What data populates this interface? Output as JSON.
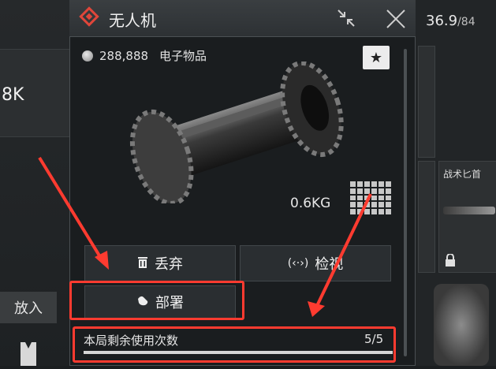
{
  "background": {
    "left_value": "8K",
    "put_button": "放入",
    "weight_current": "36.9",
    "weight_max_fragment": "/84",
    "knife_label": "战术匕首"
  },
  "dialog": {
    "title": "无人机",
    "price": "288,888",
    "category": "电子物品",
    "weight": "0.6KG",
    "actions": {
      "discard": "丢弃",
      "inspect": "检视",
      "deploy": "部署"
    },
    "usage": {
      "label": "本局剩余使用次数",
      "count": "5/5",
      "fraction": 1.0
    }
  },
  "icons": [
    "diamond-logo-icon",
    "collapse-icon",
    "close-icon",
    "star-icon",
    "coin-icon",
    "size-grid-icon",
    "trash-icon",
    "eye-icon",
    "hand-icon",
    "lock-icon"
  ],
  "colors": {
    "accent": "#e0463a",
    "highlight": "#ff3b30"
  }
}
